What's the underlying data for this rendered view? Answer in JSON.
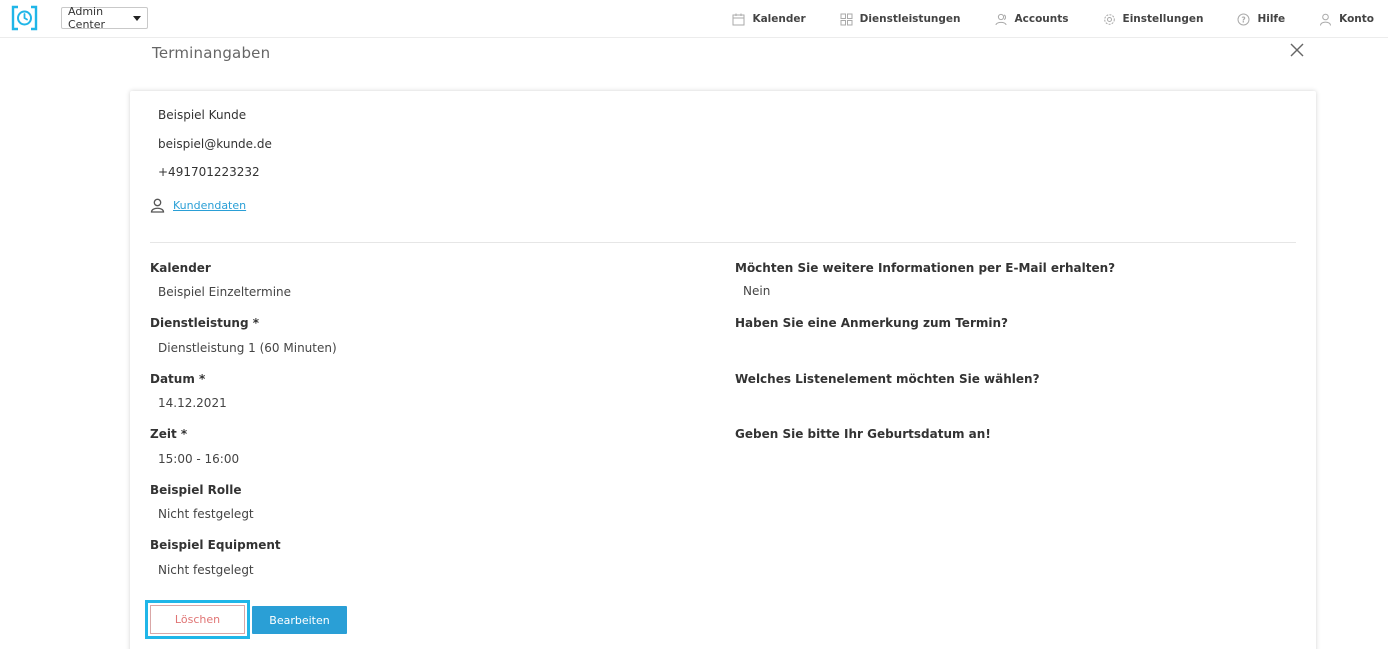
{
  "topbar": {
    "admin_select": "Admin Center",
    "nav": [
      {
        "label": "Kalender",
        "icon": "calendar-icon"
      },
      {
        "label": "Dienstleistungen",
        "icon": "grid-icon"
      },
      {
        "label": "Accounts",
        "icon": "users-icon"
      },
      {
        "label": "Einstellungen",
        "icon": "gear-icon"
      },
      {
        "label": "Hilfe",
        "icon": "help-icon"
      },
      {
        "label": "Konto",
        "icon": "user-icon"
      }
    ]
  },
  "header": {
    "title": "Terminangaben"
  },
  "customer": {
    "name": "Beispiel Kunde",
    "email": "beispiel@kunde.de",
    "phone": "+491701223232",
    "link_label": "Kundendaten"
  },
  "left_fields": [
    {
      "label": "Kalender",
      "value": "Beispiel Einzeltermine"
    },
    {
      "label": "Dienstleistung *",
      "value": "Dienstleistung 1 (60 Minuten)"
    },
    {
      "label": "Datum *",
      "value": "14.12.2021"
    },
    {
      "label": "Zeit *",
      "value": "15:00 - 16:00"
    },
    {
      "label": "Beispiel Rolle",
      "value": "Nicht festgelegt"
    },
    {
      "label": "Beispiel Equipment",
      "value": "Nicht festgelegt"
    }
  ],
  "right_fields": [
    {
      "label": "Möchten Sie weitere Informationen per E-Mail erhalten?",
      "value": "Nein"
    },
    {
      "label": "Haben Sie eine Anmerkung zum Termin?",
      "value": ""
    },
    {
      "label": "Welches Listenelement möchten Sie wählen?",
      "value": ""
    },
    {
      "label": "Geben Sie bitte Ihr Geburtsdatum an!",
      "value": ""
    }
  ],
  "actions": {
    "delete_label": "Löschen",
    "edit_label": "Bearbeiten"
  },
  "colors": {
    "accent": "#2a9fd6",
    "highlight": "#20b6e8",
    "danger_text": "#e07575"
  }
}
